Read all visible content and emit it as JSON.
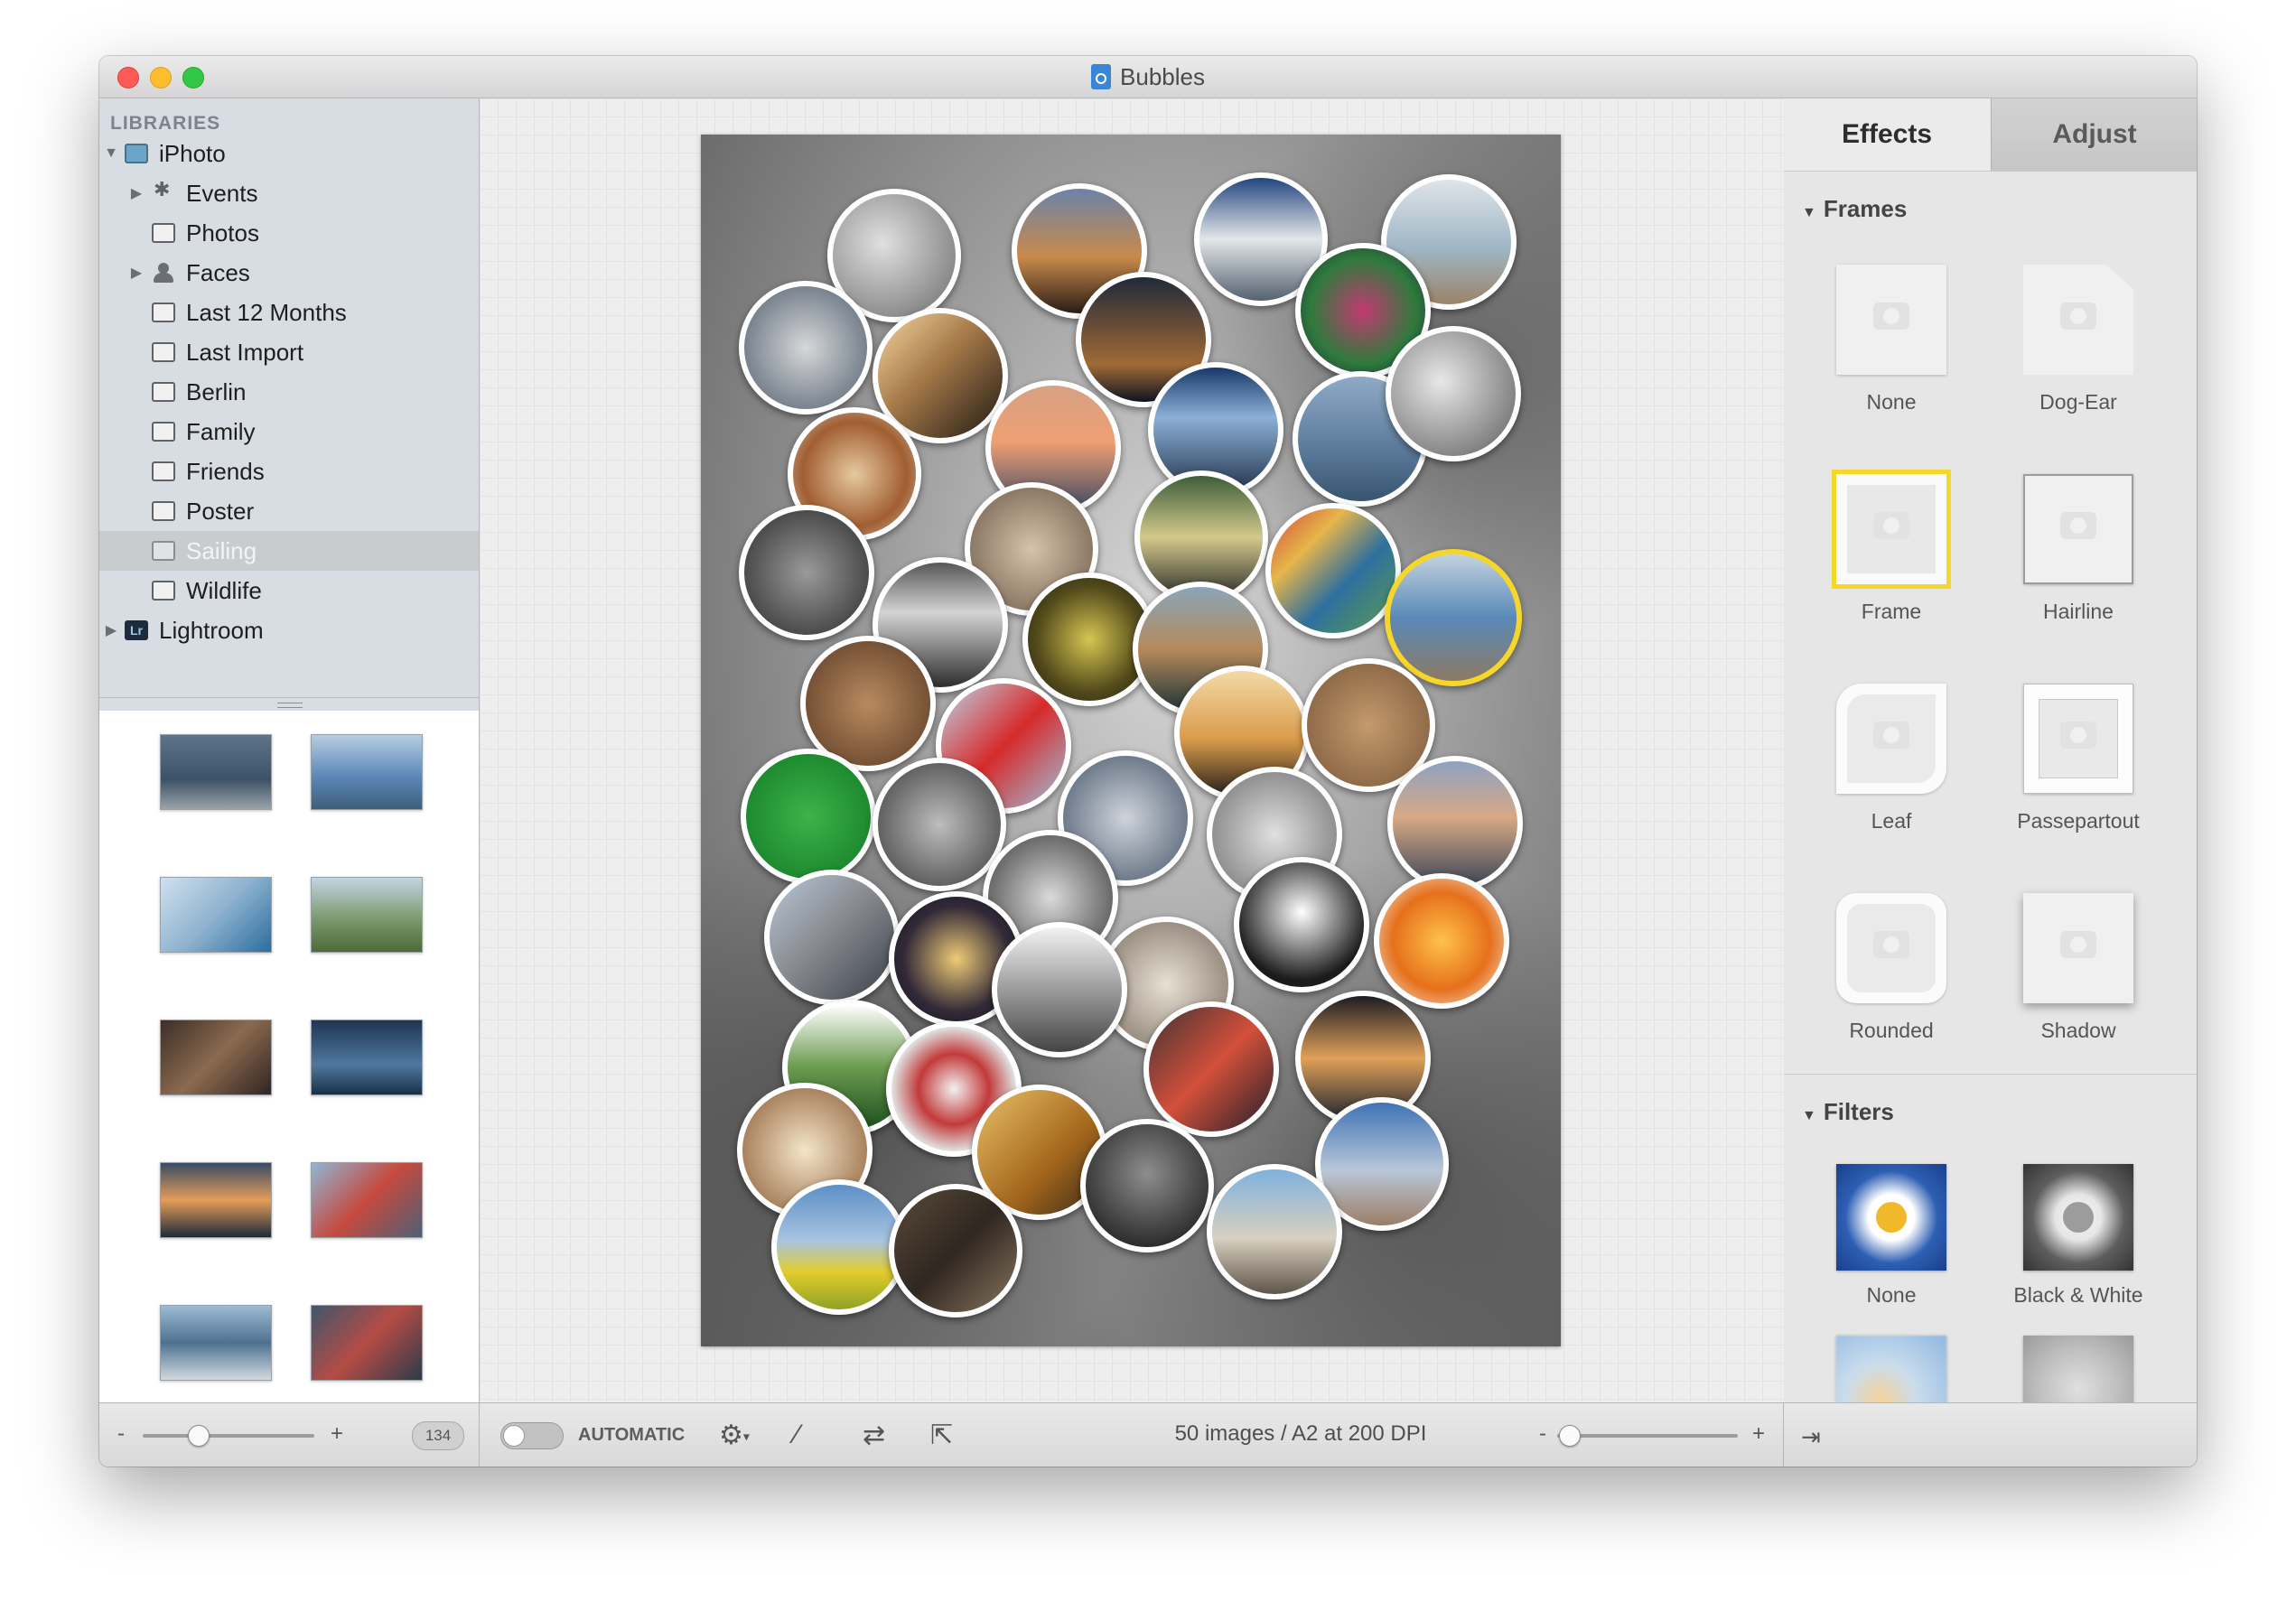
{
  "window": {
    "title": "Bubbles"
  },
  "sidebar": {
    "header": "LIBRARIES",
    "items": [
      {
        "label": "iPhoto",
        "level": 0,
        "expanded": true,
        "icon": "iphoto-icon"
      },
      {
        "label": "Events",
        "level": 1,
        "expanded": false,
        "icon": "palm-icon"
      },
      {
        "label": "Photos",
        "level": 1,
        "icon": "album-icon"
      },
      {
        "label": "Faces",
        "level": 1,
        "expanded": false,
        "icon": "person-icon"
      },
      {
        "label": "Last 12 Months",
        "level": 1,
        "icon": "calendar-icon"
      },
      {
        "label": "Last Import",
        "level": 1,
        "icon": "album-icon"
      },
      {
        "label": "Berlin",
        "level": 1,
        "icon": "album-icon"
      },
      {
        "label": "Family",
        "level": 1,
        "icon": "album-icon"
      },
      {
        "label": "Friends",
        "level": 1,
        "icon": "album-icon"
      },
      {
        "label": "Poster",
        "level": 1,
        "icon": "album-icon"
      },
      {
        "label": "Sailing",
        "level": 1,
        "icon": "album-icon",
        "selected": true
      },
      {
        "label": "Wildlife",
        "level": 1,
        "icon": "album-icon"
      },
      {
        "label": "Lightroom",
        "level": 0,
        "expanded": false,
        "icon": "lightroom-icon",
        "icon_text": "Lr"
      }
    ],
    "thumbnail_count": "134"
  },
  "toolbar": {
    "mode_label": "AUTOMATIC",
    "status": "50 images / A2 at 200 DPI"
  },
  "panel": {
    "tabs": [
      {
        "label": "Effects",
        "active": true
      },
      {
        "label": "Adjust",
        "active": false
      }
    ],
    "frames_title": "Frames",
    "frames": [
      {
        "label": "None"
      },
      {
        "label": "Dog-Ear"
      },
      {
        "label": "Frame",
        "selected": true
      },
      {
        "label": "Hairline"
      },
      {
        "label": "Leaf"
      },
      {
        "label": "Passepartout"
      },
      {
        "label": "Rounded"
      },
      {
        "label": "Shadow"
      }
    ],
    "filters_title": "Filters",
    "filters": [
      {
        "label": "None"
      },
      {
        "label": "Black & White"
      }
    ]
  },
  "colors": {
    "selection_yellow": "#f5d62a",
    "close": "#fc5b57",
    "minimize": "#fdbd2f",
    "zoom": "#33c748"
  }
}
